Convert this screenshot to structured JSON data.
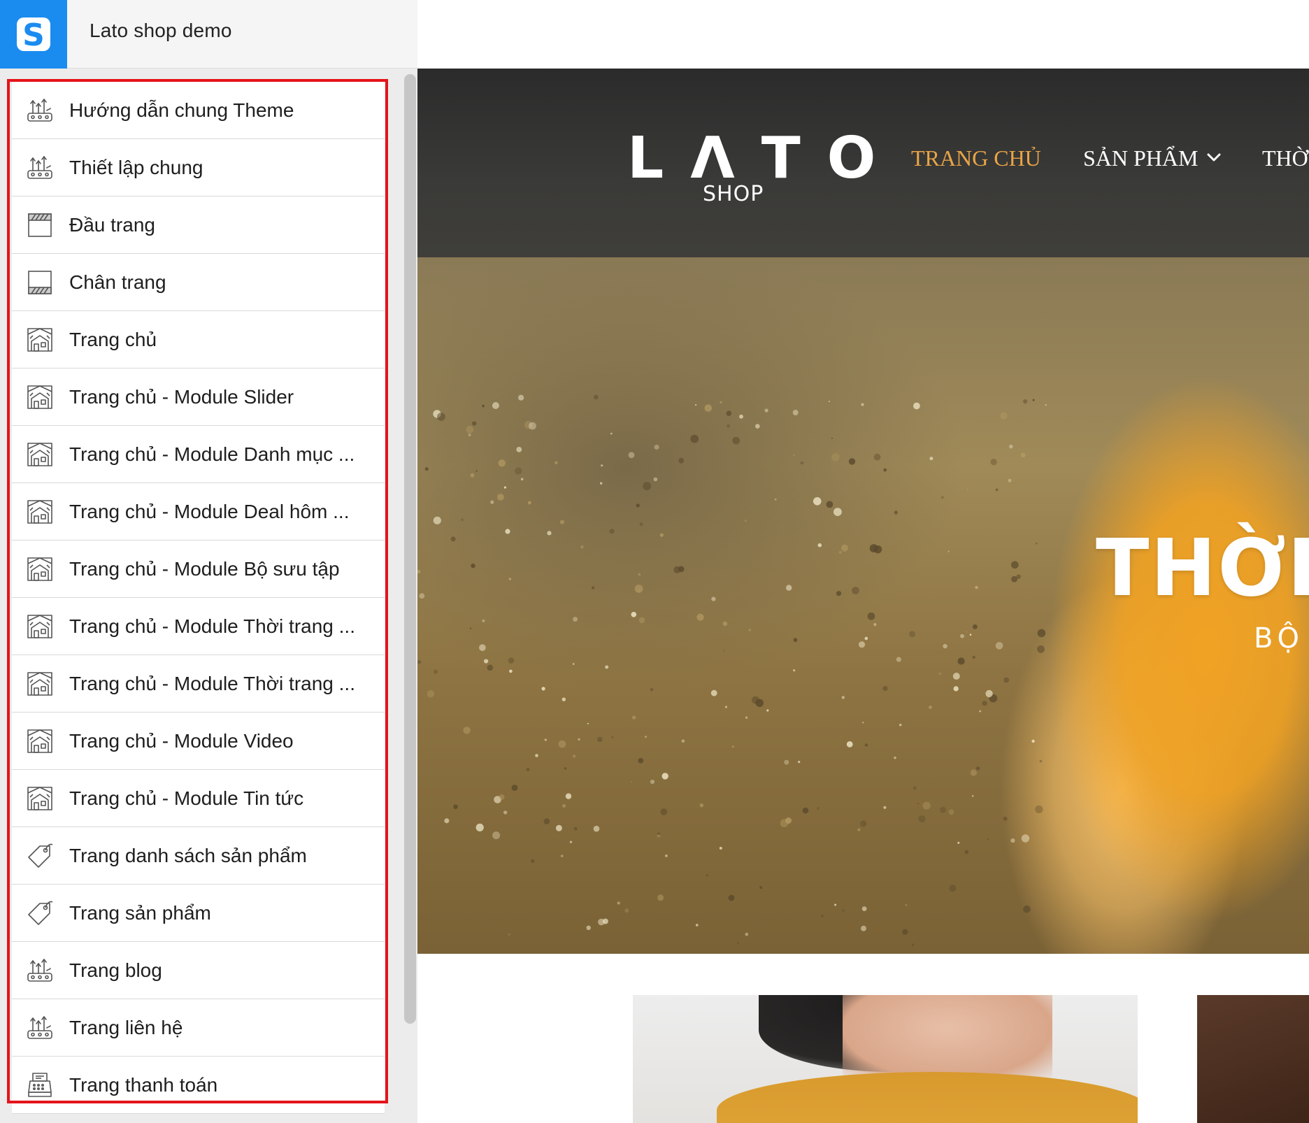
{
  "app": {
    "title": "Lato shop demo",
    "logo_letter": "S",
    "brand_color": "#1a8cf0"
  },
  "sidebar": {
    "highlight_color": "#e4141b",
    "items": [
      {
        "label": "Hướng dẫn chung Theme",
        "icon": "settings-sliders-icon"
      },
      {
        "label": "Thiết lập chung",
        "icon": "settings-sliders-icon"
      },
      {
        "label": "Đầu trang",
        "icon": "header-layout-icon"
      },
      {
        "label": "Chân trang",
        "icon": "footer-layout-icon"
      },
      {
        "label": "Trang chủ",
        "icon": "homepage-icon"
      },
      {
        "label": "Trang chủ - Module Slider",
        "icon": "homepage-icon"
      },
      {
        "label": "Trang chủ - Module Danh mục ...",
        "icon": "homepage-icon"
      },
      {
        "label": "Trang chủ - Module Deal hôm ...",
        "icon": "homepage-icon"
      },
      {
        "label": "Trang chủ - Module Bộ sưu tập",
        "icon": "homepage-icon"
      },
      {
        "label": "Trang chủ - Module Thời trang ...",
        "icon": "homepage-icon"
      },
      {
        "label": "Trang chủ - Module Thời trang ...",
        "icon": "homepage-icon"
      },
      {
        "label": "Trang chủ - Module Video",
        "icon": "homepage-icon"
      },
      {
        "label": "Trang chủ - Module Tin tức",
        "icon": "homepage-icon"
      },
      {
        "label": "Trang danh sách sản phẩm",
        "icon": "tag-icon"
      },
      {
        "label": "Trang sản phẩm",
        "icon": "tag-icon"
      },
      {
        "label": "Trang blog",
        "icon": "settings-sliders-icon"
      },
      {
        "label": "Trang liên hệ",
        "icon": "settings-sliders-icon"
      },
      {
        "label": "Trang thanh toán",
        "icon": "cash-register-icon"
      }
    ]
  },
  "preview": {
    "brand_main": "LΛTO",
    "brand_sub": "SHOP",
    "nav": {
      "home": "TRANG CHỦ",
      "products": "SẢN PHẨM",
      "fashion": "THỜ",
      "active_color": "#e9a446"
    },
    "hero": {
      "title": "THỜI",
      "subtitle": "BỘ"
    }
  }
}
